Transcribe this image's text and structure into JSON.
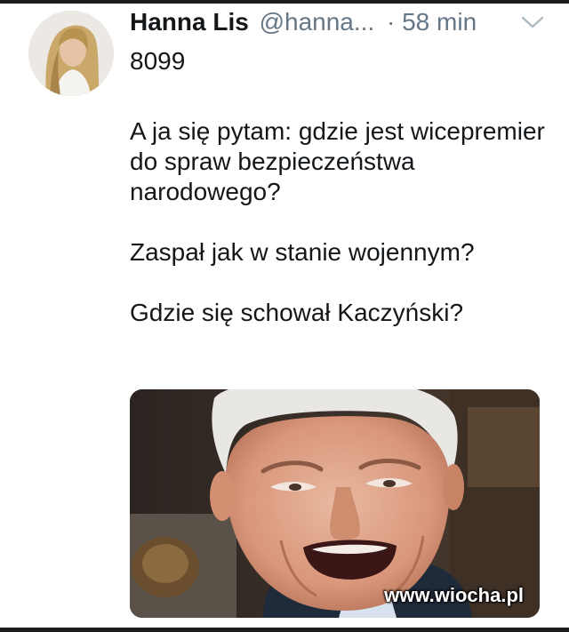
{
  "tweet": {
    "author": {
      "display_name": "Hanna Lis",
      "handle": "@hanna...",
      "avatar": "avatar-photo"
    },
    "time": "· 58 min",
    "menu_icon": "chevron-down-icon",
    "paragraphs": [
      "8099",
      "A ja się pytam: gdzie jest wicepremier do spraw bezpieczeństwa narodowego?",
      "Zaspał jak w stanie wojennym?",
      "Gdzie się schował Kaczyński?"
    ],
    "media": {
      "type": "photo",
      "watermark": "www.wiocha.pl"
    }
  },
  "colors": {
    "text": "#14171a",
    "muted": "#657786",
    "background": "#ffffff"
  }
}
